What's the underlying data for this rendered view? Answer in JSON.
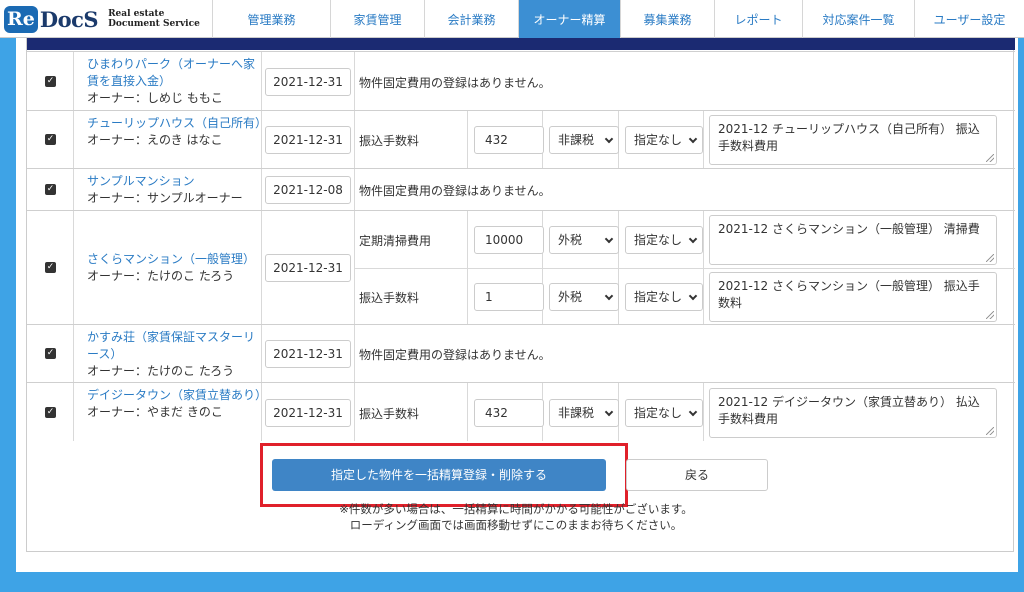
{
  "header": {
    "logo_mark": "Re",
    "logo_name": "DocS",
    "logo_sub1": "Real estate",
    "logo_sub2": "Document Service",
    "nav": [
      {
        "label": "管理業務",
        "width": 118
      },
      {
        "label": "家賃管理",
        "width": 94
      },
      {
        "label": "会計業務",
        "width": 94
      },
      {
        "label": "オーナー精算",
        "width": 102
      },
      {
        "label": "募集業務",
        "width": 94
      },
      {
        "label": "レポート",
        "width": 88
      },
      {
        "label": "対応案件一覧",
        "width": 112
      },
      {
        "label": "ユーザー設定",
        "width": 110
      }
    ],
    "active_nav": "オーナー精算"
  },
  "rows": [
    {
      "property": "ひまわりパーク（オーナーへ家賃を直接入金）",
      "owner": "オーナー：しめじ ももこ",
      "date": "2021-12-31",
      "message": "物件固定費用の登録はありません。"
    },
    {
      "property": "チューリップハウス（自己所有）",
      "owner": "オーナー：えのき はなこ",
      "date": "2021-12-31",
      "fees": [
        {
          "name": "振込手数料",
          "amount": "432",
          "tax": "非課税",
          "spec": "指定なし",
          "comment": "2021-12 チューリップハウス（自己所有） 振込手数料費用"
        }
      ]
    },
    {
      "property": "サンプルマンション",
      "owner": "オーナー：サンプルオーナー",
      "date": "2021-12-08",
      "message": "物件固定費用の登録はありません。"
    },
    {
      "property": "さくらマンション（一般管理）",
      "owner": "オーナー：たけのこ たろう",
      "date": "2021-12-31",
      "fees": [
        {
          "name": "定期清掃費用",
          "amount": "10000",
          "tax": "外税",
          "spec": "指定なし",
          "comment": "2021-12 さくらマンション（一般管理） 清掃費"
        },
        {
          "name": "振込手数料",
          "amount": "1",
          "tax": "外税",
          "spec": "指定なし",
          "comment": "2021-12 さくらマンション（一般管理） 振込手数料"
        }
      ]
    },
    {
      "property": "かすみ荘（家賃保証マスターリース）",
      "owner": "オーナー：たけのこ たろう",
      "date": "2021-12-31",
      "message": "物件固定費用の登録はありません。"
    },
    {
      "property": "デイジータウン（家賃立替あり）",
      "owner": "オーナー：やまだ きのこ",
      "date": "2021-12-31",
      "fees": [
        {
          "name": "振込手数料",
          "amount": "432",
          "tax": "非課税",
          "spec": "指定なし",
          "comment": "2021-12 デイジータウン（家賃立替あり） 払込手数料費用"
        }
      ]
    }
  ],
  "actions": {
    "submit_label": "指定した物件を一括精算登録・削除する",
    "back_label": "戻る"
  },
  "note": {
    "line1": "※件数が多い場合は、一括精算に時間がかかる可能性がございます。",
    "line2": "ローディング画面では画面移動せずにこのままお待ちください。"
  },
  "colors": {
    "accent": "#3f85c6",
    "header_bar": "#1b2a72",
    "highlight": "#e0202a",
    "link": "#2a7bc4",
    "background": "#3ea3e6"
  }
}
